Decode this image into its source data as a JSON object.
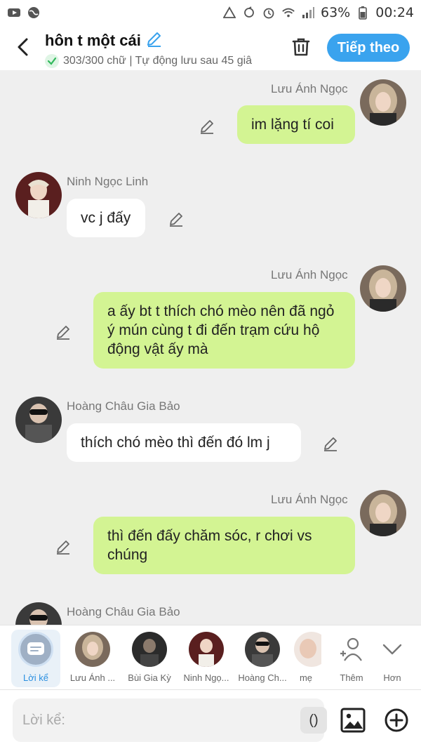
{
  "status_bar": {
    "battery_pct": "63%",
    "time": "00:24"
  },
  "header": {
    "title": "hôn t một cái",
    "subtitle": "303/300 chữ | Tự động lưu sau 45 giâ",
    "next_label": "Tiếp theo"
  },
  "messages": [
    {
      "sender": "Lưu Ánh Ngọc",
      "text": "im lặng tí coi",
      "side": "right"
    },
    {
      "sender": "Ninh Ngọc Linh",
      "text": "vc j đấy",
      "side": "left"
    },
    {
      "sender": "Lưu Ánh Ngọc",
      "text": "a ấy bt t thích chó mèo nên đã ngỏ ý mún cùng t đi đến trạm cứu hộ động vật ấy mà",
      "side": "right"
    },
    {
      "sender": "Hoàng Châu Gia Bảo",
      "text": "thích chó mèo thì đến đó lm j",
      "side": "left"
    },
    {
      "sender": "Lưu Ánh Ngọc",
      "text": "thì đến đấy chăm sóc, r chơi vs chúng",
      "side": "right"
    },
    {
      "sender": "Hoàng Châu Gia Bảo",
      "text": "",
      "side": "left"
    }
  ],
  "characters": [
    {
      "label": "Lời kể"
    },
    {
      "label": "Lưu Ánh ..."
    },
    {
      "label": "Bùi Gia Kỳ"
    },
    {
      "label": "Ninh Ngọ..."
    },
    {
      "label": "Hoàng Ch..."
    },
    {
      "label": "mẹ"
    },
    {
      "label": "Thêm"
    },
    {
      "label": "Hơn"
    }
  ],
  "input": {
    "placeholder": "Lời kể:",
    "paren": "()"
  },
  "colors": {
    "accent": "#3aa3ee",
    "bubble_green": "#d3f493",
    "bubble_white": "#ffffff",
    "background": "#efefef"
  }
}
